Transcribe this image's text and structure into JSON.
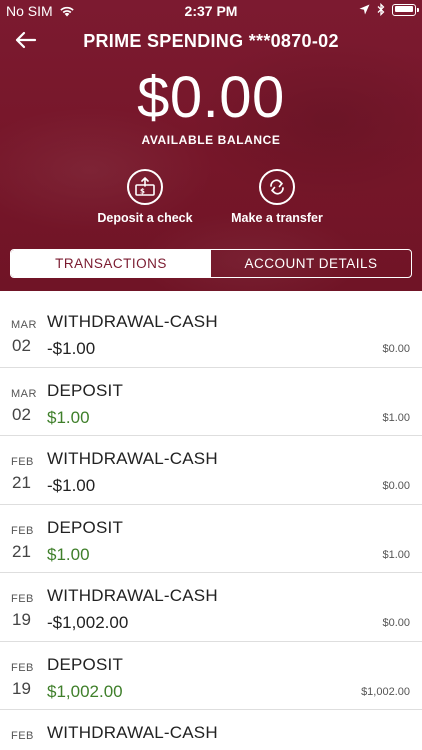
{
  "status_bar": {
    "carrier": "No SIM",
    "time": "2:37 PM"
  },
  "header": {
    "account_title": "PRIME SPENDING ***0870-02",
    "balance": "$0.00",
    "balance_label": "AVAILABLE BALANCE",
    "theme_color": "#761629",
    "actions": {
      "deposit_label": "Deposit a check",
      "transfer_label": "Make a transfer"
    },
    "tabs": {
      "transactions": "TRANSACTIONS",
      "account_details": "ACCOUNT DETAILS"
    }
  },
  "transactions": [
    {
      "month": "MAR",
      "day": "02",
      "description": "WITHDRAWAL-CASH",
      "amount": "-$1.00",
      "type": "debit",
      "balance": "$0.00"
    },
    {
      "month": "MAR",
      "day": "02",
      "description": "DEPOSIT",
      "amount": "$1.00",
      "type": "credit",
      "balance": "$1.00"
    },
    {
      "month": "FEB",
      "day": "21",
      "description": "WITHDRAWAL-CASH",
      "amount": "-$1.00",
      "type": "debit",
      "balance": "$0.00"
    },
    {
      "month": "FEB",
      "day": "21",
      "description": "DEPOSIT",
      "amount": "$1.00",
      "type": "credit",
      "balance": "$1.00"
    },
    {
      "month": "FEB",
      "day": "19",
      "description": "WITHDRAWAL-CASH",
      "amount": "-$1,002.00",
      "type": "debit",
      "balance": "$0.00"
    },
    {
      "month": "FEB",
      "day": "19",
      "description": "DEPOSIT",
      "amount": "$1,002.00",
      "type": "credit",
      "balance": "$1,002.00"
    },
    {
      "month": "FEB",
      "day": "",
      "description": "WITHDRAWAL-CASH",
      "amount": "",
      "type": "debit",
      "balance": ""
    }
  ],
  "colors": {
    "credit": "#3f7f2a",
    "debit": "#222222"
  }
}
